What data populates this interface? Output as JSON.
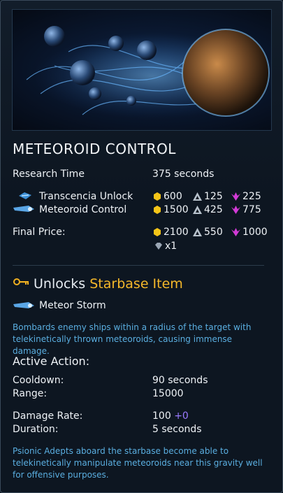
{
  "title": "METEOROID CONTROL",
  "research_time": {
    "label": "Research Time",
    "value": "375 seconds"
  },
  "requirements": [
    {
      "name": "Transcencia Unlock",
      "credits": "600",
      "metal": "125",
      "crystal": "225"
    },
    {
      "name": "Meteoroid Control",
      "credits": "1500",
      "metal": "425",
      "crystal": "775"
    }
  ],
  "final_price": {
    "label": "Final Price:",
    "credits": "2100",
    "metal": "550",
    "crystal": "1000",
    "exotic": "x1"
  },
  "unlocks": {
    "prefix": "Unlocks",
    "item_type": "Starbase Item",
    "item_name": "Meteor Storm"
  },
  "ability_description": "Bombards enemy ships within a radius of the target with telekinetically thrown meteoroids, causing immense damage.",
  "active_action": {
    "heading": "Active Action:",
    "cooldown": {
      "label": "Cooldown:",
      "value": "90 seconds"
    },
    "range": {
      "label": "Range:",
      "value": "15000"
    },
    "damage_rate": {
      "label": "Damage Rate:",
      "value": "100",
      "bonus": "+0"
    },
    "duration": {
      "label": "Duration:",
      "value": "5 seconds"
    }
  },
  "lore": "Psionic Adepts aboard the starbase become able to telekinetically manipulate meteoroids near this gravity well for offensive purposes.",
  "colors": {
    "credits": "#f5c518",
    "metal": "#b8c2cc",
    "crystal": "#d23ad6",
    "accent": "#f5b82a",
    "description": "#5aaee0"
  },
  "icons": [
    "credits-icon",
    "metal-icon",
    "crystal-icon",
    "exotic-icon",
    "research-icon",
    "key-icon",
    "meteor-icon"
  ]
}
